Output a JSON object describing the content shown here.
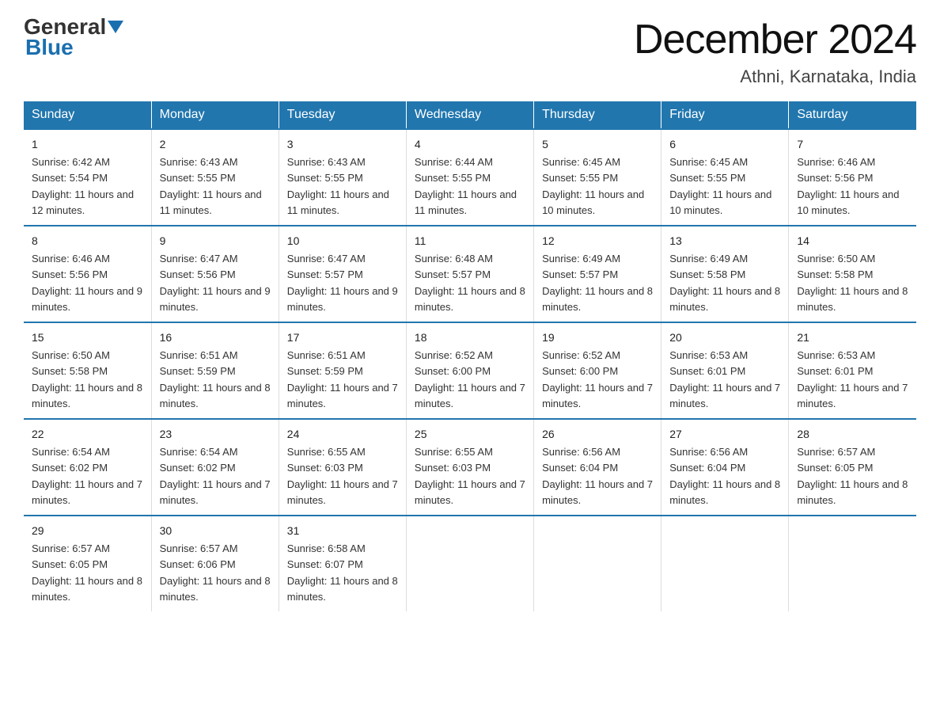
{
  "header": {
    "logo_general": "General",
    "logo_blue": "Blue",
    "main_title": "December 2024",
    "subtitle": "Athni, Karnataka, India"
  },
  "days_of_week": [
    "Sunday",
    "Monday",
    "Tuesday",
    "Wednesday",
    "Thursday",
    "Friday",
    "Saturday"
  ],
  "weeks": [
    [
      {
        "day": "1",
        "sunrise": "6:42 AM",
        "sunset": "5:54 PM",
        "daylight": "11 hours and 12 minutes."
      },
      {
        "day": "2",
        "sunrise": "6:43 AM",
        "sunset": "5:55 PM",
        "daylight": "11 hours and 11 minutes."
      },
      {
        "day": "3",
        "sunrise": "6:43 AM",
        "sunset": "5:55 PM",
        "daylight": "11 hours and 11 minutes."
      },
      {
        "day": "4",
        "sunrise": "6:44 AM",
        "sunset": "5:55 PM",
        "daylight": "11 hours and 11 minutes."
      },
      {
        "day": "5",
        "sunrise": "6:45 AM",
        "sunset": "5:55 PM",
        "daylight": "11 hours and 10 minutes."
      },
      {
        "day": "6",
        "sunrise": "6:45 AM",
        "sunset": "5:55 PM",
        "daylight": "11 hours and 10 minutes."
      },
      {
        "day": "7",
        "sunrise": "6:46 AM",
        "sunset": "5:56 PM",
        "daylight": "11 hours and 10 minutes."
      }
    ],
    [
      {
        "day": "8",
        "sunrise": "6:46 AM",
        "sunset": "5:56 PM",
        "daylight": "11 hours and 9 minutes."
      },
      {
        "day": "9",
        "sunrise": "6:47 AM",
        "sunset": "5:56 PM",
        "daylight": "11 hours and 9 minutes."
      },
      {
        "day": "10",
        "sunrise": "6:47 AM",
        "sunset": "5:57 PM",
        "daylight": "11 hours and 9 minutes."
      },
      {
        "day": "11",
        "sunrise": "6:48 AM",
        "sunset": "5:57 PM",
        "daylight": "11 hours and 8 minutes."
      },
      {
        "day": "12",
        "sunrise": "6:49 AM",
        "sunset": "5:57 PM",
        "daylight": "11 hours and 8 minutes."
      },
      {
        "day": "13",
        "sunrise": "6:49 AM",
        "sunset": "5:58 PM",
        "daylight": "11 hours and 8 minutes."
      },
      {
        "day": "14",
        "sunrise": "6:50 AM",
        "sunset": "5:58 PM",
        "daylight": "11 hours and 8 minutes."
      }
    ],
    [
      {
        "day": "15",
        "sunrise": "6:50 AM",
        "sunset": "5:58 PM",
        "daylight": "11 hours and 8 minutes."
      },
      {
        "day": "16",
        "sunrise": "6:51 AM",
        "sunset": "5:59 PM",
        "daylight": "11 hours and 8 minutes."
      },
      {
        "day": "17",
        "sunrise": "6:51 AM",
        "sunset": "5:59 PM",
        "daylight": "11 hours and 7 minutes."
      },
      {
        "day": "18",
        "sunrise": "6:52 AM",
        "sunset": "6:00 PM",
        "daylight": "11 hours and 7 minutes."
      },
      {
        "day": "19",
        "sunrise": "6:52 AM",
        "sunset": "6:00 PM",
        "daylight": "11 hours and 7 minutes."
      },
      {
        "day": "20",
        "sunrise": "6:53 AM",
        "sunset": "6:01 PM",
        "daylight": "11 hours and 7 minutes."
      },
      {
        "day": "21",
        "sunrise": "6:53 AM",
        "sunset": "6:01 PM",
        "daylight": "11 hours and 7 minutes."
      }
    ],
    [
      {
        "day": "22",
        "sunrise": "6:54 AM",
        "sunset": "6:02 PM",
        "daylight": "11 hours and 7 minutes."
      },
      {
        "day": "23",
        "sunrise": "6:54 AM",
        "sunset": "6:02 PM",
        "daylight": "11 hours and 7 minutes."
      },
      {
        "day": "24",
        "sunrise": "6:55 AM",
        "sunset": "6:03 PM",
        "daylight": "11 hours and 7 minutes."
      },
      {
        "day": "25",
        "sunrise": "6:55 AM",
        "sunset": "6:03 PM",
        "daylight": "11 hours and 7 minutes."
      },
      {
        "day": "26",
        "sunrise": "6:56 AM",
        "sunset": "6:04 PM",
        "daylight": "11 hours and 7 minutes."
      },
      {
        "day": "27",
        "sunrise": "6:56 AM",
        "sunset": "6:04 PM",
        "daylight": "11 hours and 8 minutes."
      },
      {
        "day": "28",
        "sunrise": "6:57 AM",
        "sunset": "6:05 PM",
        "daylight": "11 hours and 8 minutes."
      }
    ],
    [
      {
        "day": "29",
        "sunrise": "6:57 AM",
        "sunset": "6:05 PM",
        "daylight": "11 hours and 8 minutes."
      },
      {
        "day": "30",
        "sunrise": "6:57 AM",
        "sunset": "6:06 PM",
        "daylight": "11 hours and 8 minutes."
      },
      {
        "day": "31",
        "sunrise": "6:58 AM",
        "sunset": "6:07 PM",
        "daylight": "11 hours and 8 minutes."
      },
      null,
      null,
      null,
      null
    ]
  ]
}
